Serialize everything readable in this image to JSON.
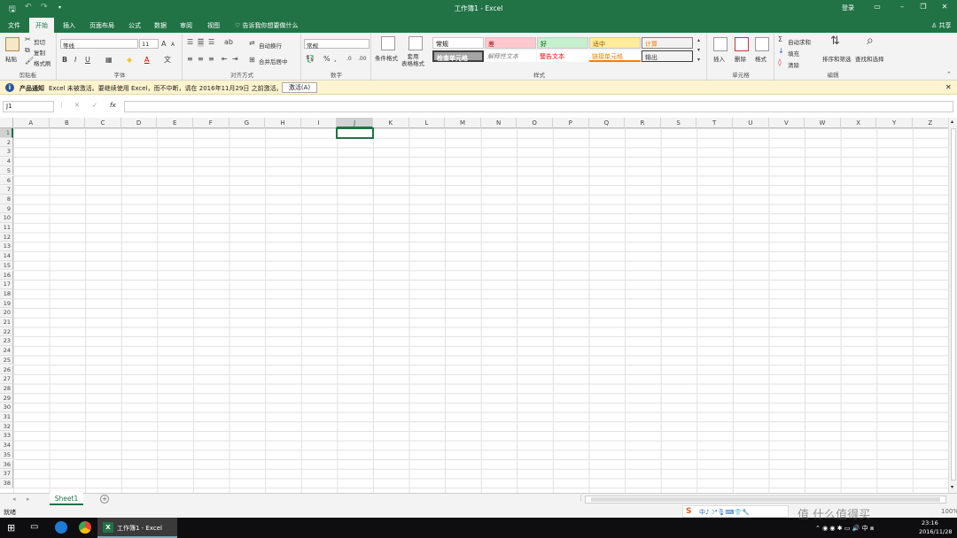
{
  "app": {
    "title": "工作簿1 - Excel",
    "login": "登录",
    "share": "共享"
  },
  "tabs": [
    "文件",
    "开始",
    "插入",
    "页面布局",
    "公式",
    "数据",
    "审阅",
    "视图"
  ],
  "tellme": "告诉我你想要做什么",
  "ribbon": {
    "clipboard": {
      "paste": "粘贴",
      "cut": "剪切",
      "copy": "复制",
      "painter": "格式刷",
      "label": "剪贴板"
    },
    "font": {
      "name": "等线",
      "size": "11",
      "bold": "B",
      "italic": "I",
      "underline": "U",
      "label": "字体"
    },
    "align": {
      "wrap": "自动换行",
      "merge": "合并后居中",
      "label": "对齐方式"
    },
    "number": {
      "format": "常规",
      "percent": "%",
      "label": "数字"
    },
    "styles": {
      "cond": "条件格式",
      "table": "套用\n表格格式",
      "label": "样式",
      "cells": [
        {
          "text": "常规",
          "bg": "#ffffff",
          "fg": "#000000"
        },
        {
          "text": "差",
          "bg": "#ffc7ce",
          "fg": "#9c0006"
        },
        {
          "text": "好",
          "bg": "#c6efce",
          "fg": "#006100"
        },
        {
          "text": "适中",
          "bg": "#ffeb9c",
          "fg": "#9c5700"
        },
        {
          "text": "计算",
          "bg": "#f2f2f2",
          "fg": "#fa7d00"
        },
        {
          "text": "检查单元格",
          "bg": "#a5a5a5",
          "fg": "#ffffff"
        },
        {
          "text": "解释性文本",
          "bg": "#ffffff",
          "fg": "#7f7f7f"
        },
        {
          "text": "警告文本",
          "bg": "#ffffff",
          "fg": "#ff0000"
        },
        {
          "text": "链接单元格",
          "bg": "#ffffff",
          "fg": "#fa7d00"
        },
        {
          "text": "输出",
          "bg": "#f2f2f2",
          "fg": "#3f3f3f"
        }
      ]
    },
    "cells": {
      "insert": "插入",
      "delete": "删除",
      "format": "格式",
      "label": "单元格"
    },
    "editing": {
      "autosum": "自动求和",
      "fill": "填充",
      "clear": "清除",
      "sort": "排序和筛选",
      "find": "查找和选择",
      "label": "编辑"
    }
  },
  "infobar": {
    "title": "产品通知",
    "message": "Excel 未被激活。要继续使用 Excel，而不中断，请在 2016年11月29日 之前激活。",
    "button": "激活(A)"
  },
  "formula": {
    "namebox": "J1",
    "fx": "fx",
    "value": ""
  },
  "columns": [
    "A",
    "B",
    "C",
    "D",
    "E",
    "F",
    "G",
    "H",
    "I",
    "J",
    "K",
    "L",
    "M",
    "N",
    "O",
    "P",
    "Q",
    "R",
    "S",
    "T",
    "U",
    "V",
    "W",
    "X",
    "Y",
    "Z"
  ],
  "rows": [
    "1",
    "2",
    "3",
    "4",
    "5",
    "6",
    "7",
    "8",
    "9",
    "10",
    "11",
    "12",
    "13",
    "14",
    "15",
    "16",
    "17",
    "18",
    "19",
    "20",
    "21",
    "22",
    "23",
    "24",
    "25",
    "26",
    "27",
    "28",
    "29",
    "30",
    "31",
    "32",
    "33",
    "34",
    "35",
    "36",
    "37",
    "38"
  ],
  "sheet": {
    "tab": "Sheet1",
    "add": "+"
  },
  "status": {
    "ready": "就绪",
    "zoom": "100%"
  },
  "taskbar": {
    "app": "工作簿1 - Excel",
    "time": "23:16",
    "date": "2016/11/28",
    "watermark": "值 什么值得买"
  },
  "colors": {
    "accent": "#217346",
    "infobar": "#fff4ce"
  }
}
